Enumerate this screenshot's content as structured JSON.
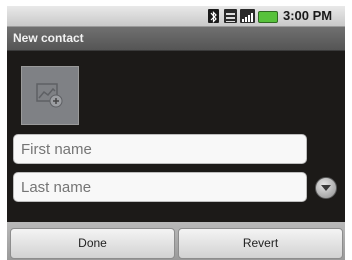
{
  "status_bar": {
    "time": "3:00 PM",
    "icons": [
      "bluetooth-icon",
      "signal-icon",
      "network-icon",
      "battery-icon"
    ],
    "battery_color": "#57c23b"
  },
  "title_bar": {
    "title": "New contact"
  },
  "form": {
    "photo_icon": "add-photo-icon",
    "first_name": {
      "placeholder": "First name",
      "value": ""
    },
    "last_name": {
      "placeholder": "Last name",
      "value": ""
    },
    "more_icon": "chevron-down-circle-icon"
  },
  "buttons": {
    "done_label": "Done",
    "revert_label": "Revert"
  }
}
